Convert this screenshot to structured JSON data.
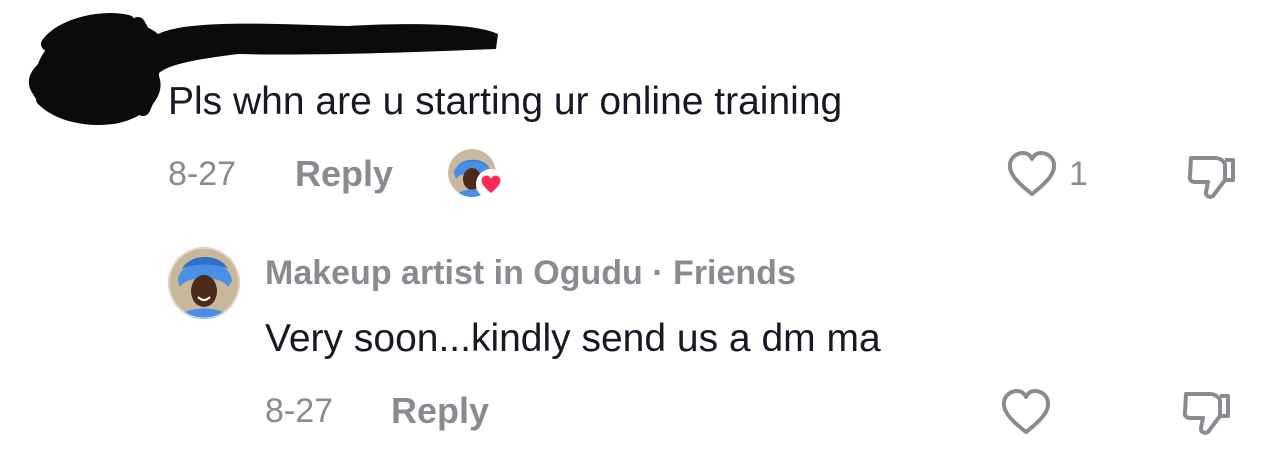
{
  "comments": [
    {
      "text": "Pls whn are u starting ur online training",
      "date": "8-27",
      "reply_label": "Reply",
      "like_count": "1",
      "creator_liked": true
    },
    {
      "username": "Makeup artist in Ogudu",
      "separator": "·",
      "relation": "Friends",
      "text": "Very soon...kindly send us a dm ma",
      "date": "8-27",
      "reply_label": "Reply"
    }
  ],
  "icons": {
    "like": "heart-outline-icon",
    "dislike": "thumbs-down-icon",
    "creator_like_badge": "red-heart-icon"
  },
  "colors": {
    "text": "#161823",
    "muted": "#8a8b91",
    "heart_badge": "#fe2c55"
  }
}
